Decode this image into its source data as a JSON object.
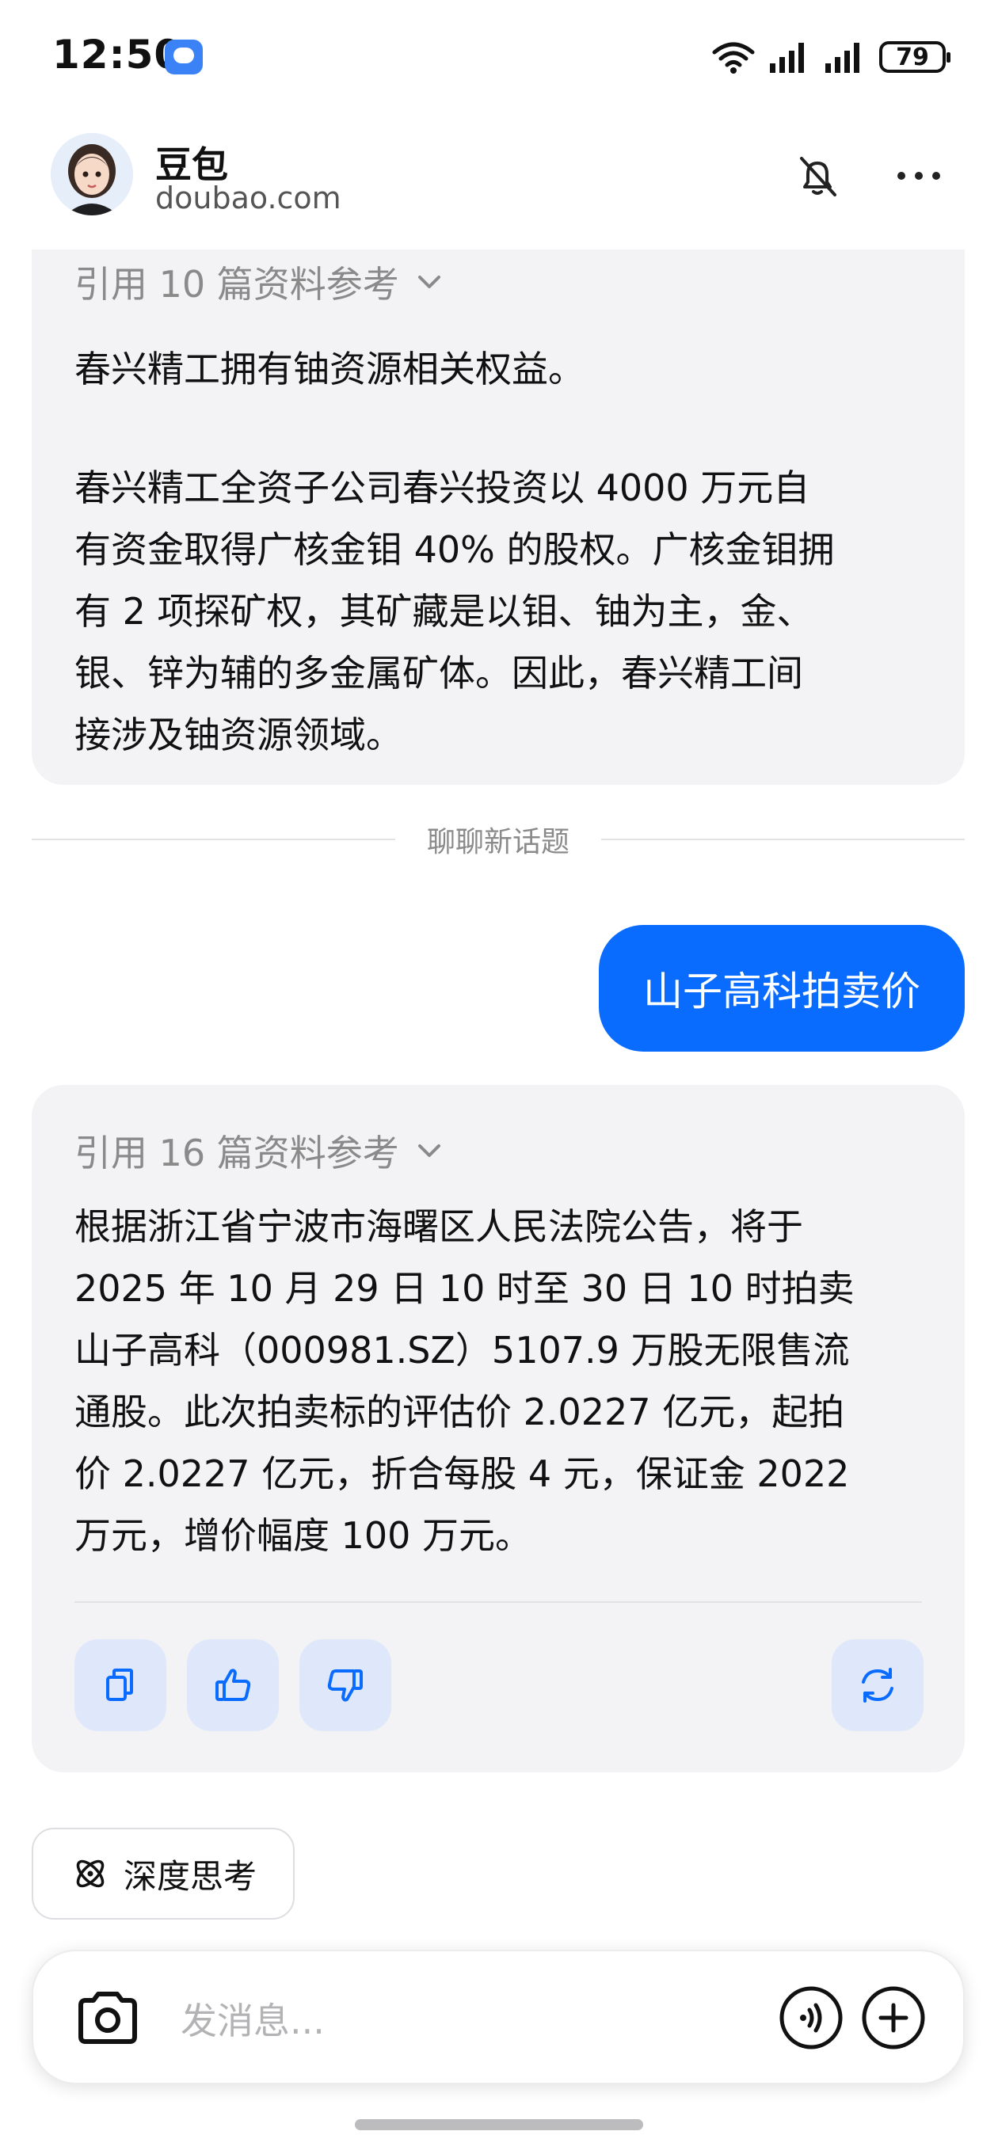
{
  "status_bar": {
    "time": "12:50",
    "battery": "79"
  },
  "header": {
    "bot_name": "豆包",
    "bot_domain": "doubao.com"
  },
  "messages": {
    "prev_answer": {
      "ref_label": "引用 10 篇资料参考",
      "para1": "春兴精工拥有铀资源相关权益。",
      "para2_lines": [
        "春兴精工全资子公司春兴投资以 4000 万元自",
        "有资金取得广核金钼 40% 的股权。广核金钼拥",
        "有 2 项探矿权，其矿藏是以钼、铀为主，金、",
        "银、锌为辅的多金属矿体。因此，春兴精工间",
        "接涉及铀资源领域。"
      ]
    },
    "divider_label": "聊聊新话题",
    "user_message": "山子高科拍卖价",
    "answer": {
      "ref_label": "引用 16 篇资料参考",
      "lines": [
        "根据浙江省宁波市海曙区人民法院公告，将于",
        "2025 年 10 月 29 日 10 时至 30 日 10 时拍卖",
        "山子高科（000981.SZ）5107.9 万股无限售流",
        "通股。此次拍卖标的评估价 2.0227 亿元，起拍",
        "价 2.0227 亿元，折合每股 4 元，保证金 2022",
        "万元，增价幅度 100 万元。"
      ]
    }
  },
  "deep_think_label": "深度思考",
  "input": {
    "placeholder": "发消息..."
  },
  "colors": {
    "accent": "#0a6cff",
    "bubble_bg": "#f3f3f5",
    "action_bg": "#dfe8fb"
  },
  "icons": [
    "message-badge-icon",
    "wifi-icon",
    "signal-icon",
    "mute-icon",
    "more-icon",
    "chevron-down-icon",
    "copy-icon",
    "thumbs-up-icon",
    "thumbs-down-icon",
    "regenerate-icon",
    "deep-think-icon",
    "camera-icon",
    "voice-icon",
    "plus-icon"
  ]
}
